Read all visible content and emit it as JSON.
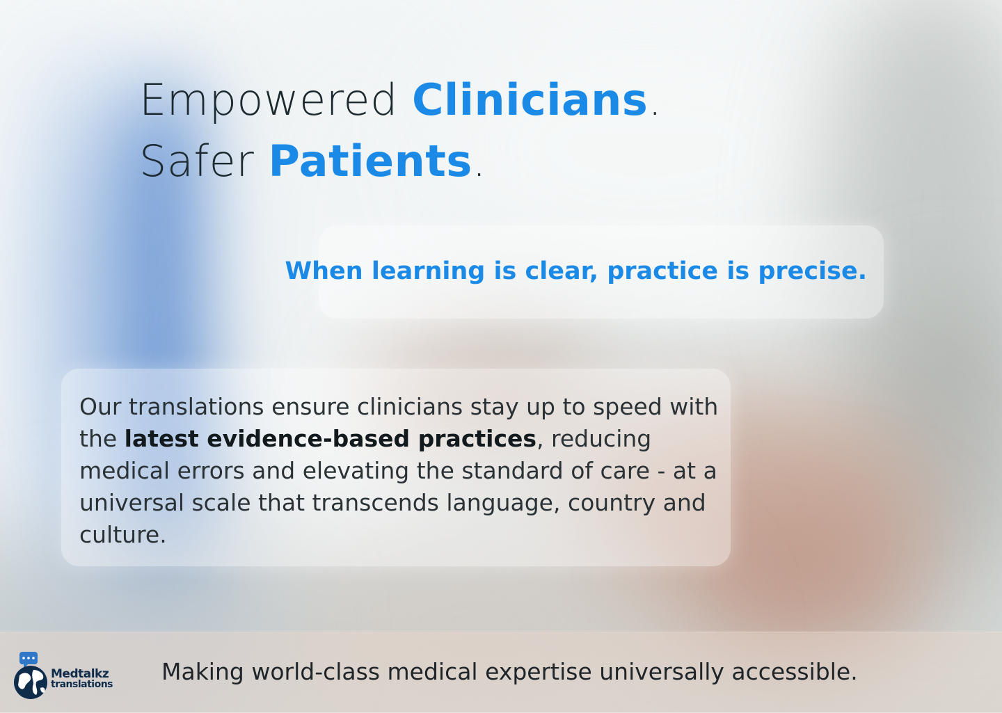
{
  "headline": {
    "line1_text": "Empowered ",
    "line1_accent": "Clinicians",
    "line1_end": ".",
    "line2_text": "Safer ",
    "line2_accent": "Patients",
    "line2_end": "."
  },
  "tagline": "When learning is clear, practice is precise.",
  "body": {
    "before": "Our translations ensure clinicians stay up to speed with the ",
    "emphasis": "latest evidence-based practices",
    "after": ", reducing medical errors and elevating the standard of care - at a universal scale that transcends language, country and culture."
  },
  "footer": {
    "tagline": "Making world-class medical expertise universally accessible.",
    "logo_line1": "Medtalkz",
    "logo_line2": "translations"
  },
  "colors": {
    "accent": "#1a8ae6",
    "text_dark": "#1c2a30",
    "logo_navy": "#0f2c4a"
  }
}
